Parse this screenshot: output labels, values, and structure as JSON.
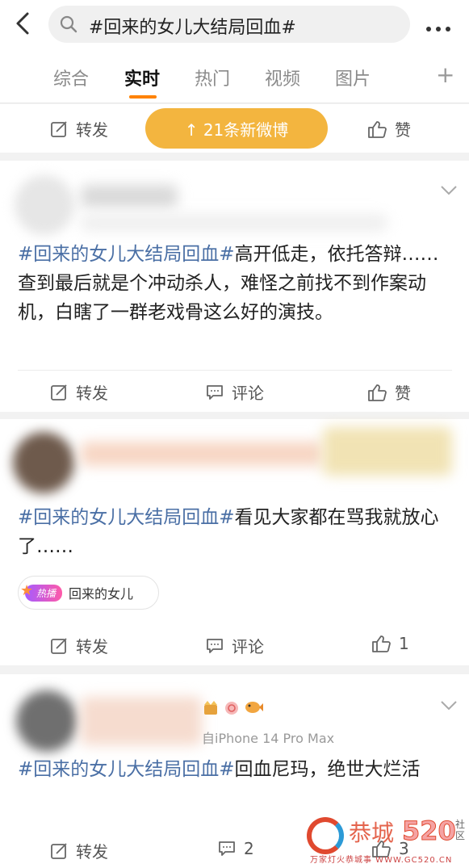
{
  "search": {
    "query": "#回来的女儿大结局回血#"
  },
  "tabs": [
    {
      "label": "综合"
    },
    {
      "label": "实时"
    },
    {
      "label": "热门"
    },
    {
      "label": "视频"
    },
    {
      "label": "图片"
    }
  ],
  "top_actions": {
    "repost": "转发",
    "new_posts": "↑ 21条新微博",
    "like": "赞"
  },
  "posts": [
    {
      "topic": "#回来的女儿大结局回血#",
      "text": "高开低走，依托答辩……查到最后就是个冲动杀人，难怪之前找不到作案动机，白瞎了一群老戏骨这么好的演技。",
      "repost": "转发",
      "comment": "评论",
      "like": "赞"
    },
    {
      "topic": "#回来的女儿大结局回血#",
      "text": "看见大家都在骂我就放心了……",
      "hot_badge": "热播",
      "hot_label": "回来的女儿",
      "repost": "转发",
      "comment": "评论",
      "like": "1"
    },
    {
      "source": "自iPhone 14 Pro Max",
      "topic": "#回来的女儿大结局回血#",
      "text": "回血尼玛，绝世大烂活",
      "repost": "转发",
      "comment": "2",
      "like": "3"
    }
  ],
  "watermark": {
    "brand": "恭城",
    "num": "520",
    "side": "社区",
    "sub": "万家灯火恭城事 WWW.GC520.CN"
  },
  "colors": {
    "accent": "#ff8200",
    "pill": "#f3b53f",
    "topic": "#4a6fa5"
  }
}
